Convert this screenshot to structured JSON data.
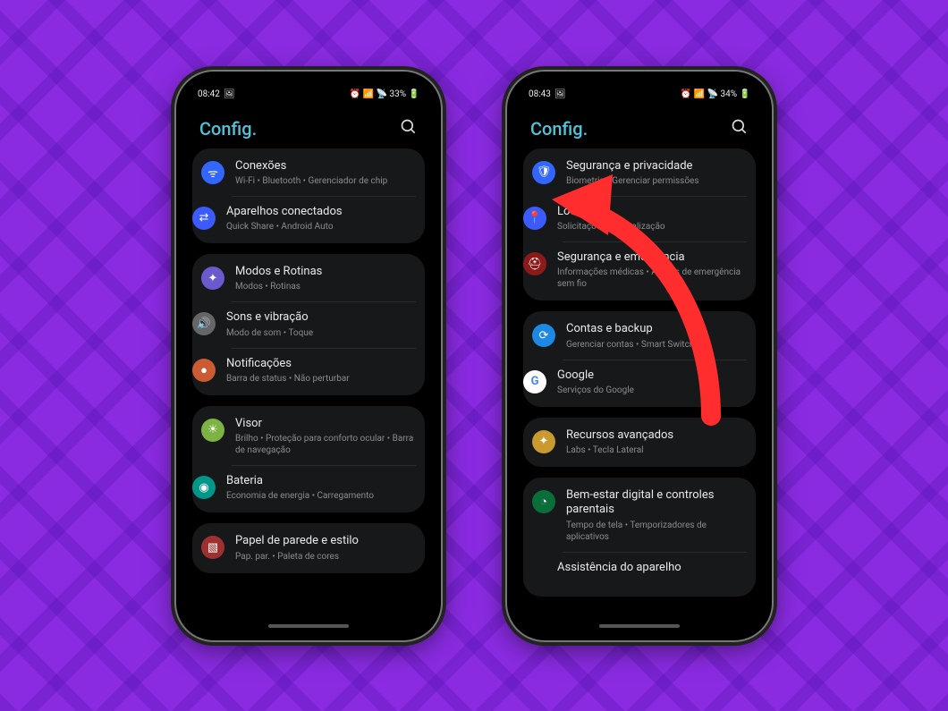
{
  "annotation": {
    "color": "#ff2d2d",
    "points_to": "seguranca-e-privacidade"
  },
  "phones": [
    {
      "status": {
        "time": "08:42",
        "left_icons": "🖼",
        "right_icons": "⏰ 📶 📡 33% 🔋",
        "battery_text": "33%"
      },
      "header": {
        "title": "Config."
      },
      "groups": [
        {
          "items": [
            {
              "id": "conexoes",
              "icon": "wifi",
              "icon_color": "c-blue",
              "title": "Conexões",
              "sub": "Wi-Fi  •  Bluetooth  •  Gerenciador de chip"
            },
            {
              "id": "aparelhos-conectados",
              "icon": "devices",
              "icon_color": "c-blue2",
              "title": "Aparelhos conectados",
              "sub": "Quick Share  •  Android Auto"
            }
          ]
        },
        {
          "items": [
            {
              "id": "modos-e-rotinas",
              "icon": "routine",
              "icon_color": "c-purple",
              "title": "Modos e Rotinas",
              "sub": "Modos  •  Rotinas"
            },
            {
              "id": "sons-e-vibracao",
              "icon": "sound",
              "icon_color": "c-grey",
              "title": "Sons e vibração",
              "sub": "Modo de som  •  Toque"
            },
            {
              "id": "notificacoes",
              "icon": "bell",
              "icon_color": "c-orange",
              "title": "Notificações",
              "sub": "Barra de status  •  Não perturbar"
            }
          ]
        },
        {
          "items": [
            {
              "id": "visor",
              "icon": "display",
              "icon_color": "c-green",
              "title": "Visor",
              "sub": "Brilho  •  Proteção para conforto ocular  •  Barra de navegação"
            },
            {
              "id": "bateria",
              "icon": "battery",
              "icon_color": "c-teal",
              "title": "Bateria",
              "sub": "Economia de energia  •  Carregamento"
            }
          ]
        },
        {
          "cut": true,
          "items": [
            {
              "id": "papel-de-parede",
              "icon": "wallpaper",
              "icon_color": "c-red",
              "title": "Papel de parede e estilo",
              "sub": "Pap. par.  •  Paleta de cores"
            }
          ]
        }
      ]
    },
    {
      "status": {
        "time": "08:43",
        "left_icons": "🖼",
        "right_icons": "⏰ 📶 📡 34% 🔋",
        "battery_text": "34%"
      },
      "header": {
        "title": "Config."
      },
      "groups": [
        {
          "items": [
            {
              "id": "seguranca-e-privacidade",
              "icon": "shield",
              "icon_color": "c-blue",
              "title": "Segurança e privacidade",
              "sub": "Biometria  •  Gerenciar permissões"
            },
            {
              "id": "local",
              "icon": "location",
              "icon_color": "c-blue2",
              "title": "Local",
              "sub": "Solicitações de localização"
            },
            {
              "id": "seguranca-e-emergencia",
              "icon": "siren",
              "icon_color": "c-darkred",
              "title": "Segurança e emergência",
              "sub": "Informações médicas  •  Alertas de emergência sem fio"
            }
          ]
        },
        {
          "items": [
            {
              "id": "contas-e-backup",
              "icon": "backup",
              "icon_color": "c-cyan",
              "title": "Contas e backup",
              "sub": "Gerenciar contas  •  Smart Switch"
            },
            {
              "id": "google",
              "icon": "G",
              "icon_color": "c-google",
              "title": "Google",
              "sub": "Serviços do Google"
            }
          ]
        },
        {
          "items": [
            {
              "id": "recursos-avancados",
              "icon": "labs",
              "icon_color": "c-yellow",
              "title": "Recursos avançados",
              "sub": "Labs  •  Tecla Lateral"
            }
          ]
        },
        {
          "cut": true,
          "items": [
            {
              "id": "bem-estar-digital",
              "icon": "wellbeing",
              "icon_color": "c-darkgreen",
              "title": "Bem-estar digital e controles parentais",
              "sub": "Tempo de tela  •  Temporizadores de aplicativos"
            },
            {
              "id": "assistencia-do-aparelho",
              "icon": "",
              "icon_color": "",
              "title": "Assistência do aparelho",
              "sub": ""
            }
          ]
        }
      ]
    }
  ]
}
